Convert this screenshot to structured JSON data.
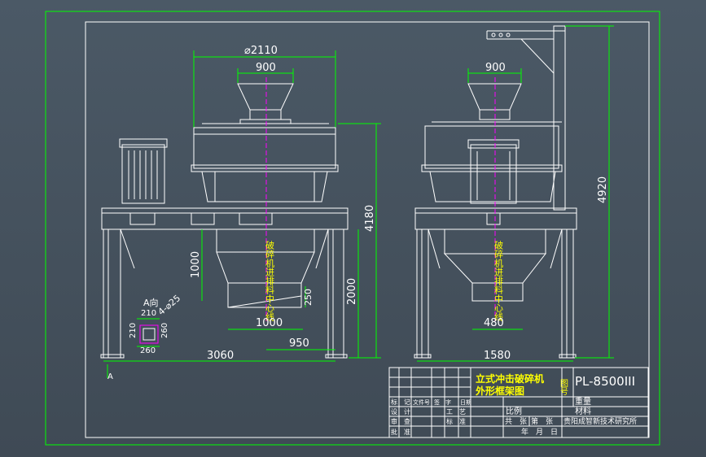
{
  "drawing": {
    "title_cn": "立式冲击破碎机",
    "subtitle_cn": "外形框架图",
    "drawing_no_label": "图号",
    "drawing_no": "PL-8500III",
    "weight_label": "重量",
    "material_label": "材料",
    "scale_label": "比例",
    "sheet_count": "共　张",
    "sheet_index": "第　张",
    "institute": "贵阳成智新技术研究所",
    "date_label": "年　月　日",
    "rows": [
      "标　记",
      "设　计",
      "审　查",
      "批　准"
    ],
    "row_extra": [
      "处数",
      "文件号",
      "签　字",
      "日期"
    ],
    "process_label": "工　艺",
    "standard_label": "标　准"
  },
  "dims_left": {
    "dia": "⌀2110",
    "top_width": "900",
    "h_total": "4180",
    "h_frame": "2000",
    "h_cone": "1000",
    "w_cone": "1000",
    "w_outlet": "950",
    "w_base": "3060",
    "outlet_250": "250",
    "a_view": "A向",
    "a_210a": "210",
    "a_210b": "210",
    "a_260a": "260",
    "a_260b": "260",
    "a_hole": "4-⌀25",
    "vertical_text": "破碎机进排料中心线",
    "arrow_a": "A"
  },
  "dims_right": {
    "top_width": "900",
    "h_total": "4920",
    "w_outlet": "480",
    "w_base": "1580",
    "vertical_text": "破碎机进排料中心线"
  }
}
